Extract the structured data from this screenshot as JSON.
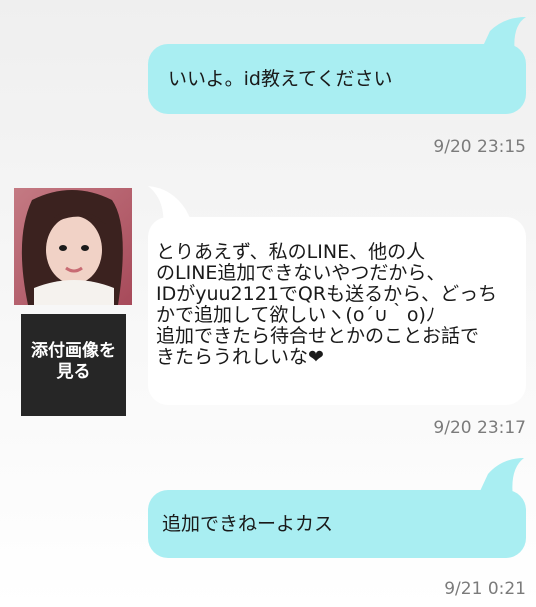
{
  "messages": [
    {
      "type": "sent",
      "text": "いいよ。id教えてください",
      "timestamp": "9/20 23:15"
    },
    {
      "type": "received",
      "text": "とりあえず、私のLINE、他の人\nのLINE追加できないやつだから、\nIDがyuu2121でQRも送るから、どっち\nかで追加して欲しいヽ(o´∪｀o)ﾉ\n追加できたら待合せとかのことお話で\nきたらうれしいな❤",
      "timestamp": "9/20 23:17"
    },
    {
      "type": "sent",
      "text": "追加できねーよカス",
      "timestamp": "9/21 0:21"
    }
  ],
  "attachment": {
    "label": "添付画像を\n見る"
  },
  "colors": {
    "sent_bubble": "#a9eef2",
    "received_bubble": "#ffffff",
    "timestamp": "#7b7b7b"
  }
}
